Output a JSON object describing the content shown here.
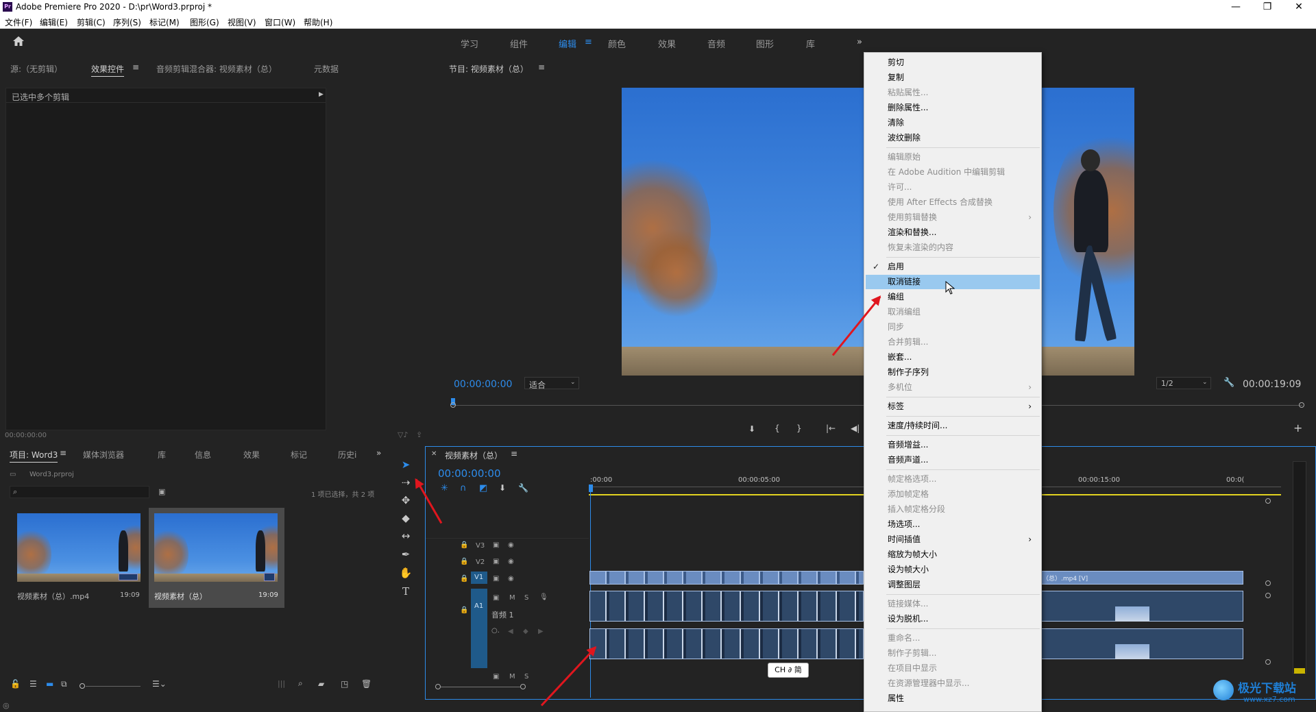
{
  "window": {
    "title": "Adobe Premiere Pro 2020 - D:\\pr\\Word3.prproj *",
    "app_icon": "Pr"
  },
  "menubar": [
    "文件(F)",
    "编辑(E)",
    "剪辑(C)",
    "序列(S)",
    "标记(M)",
    "图形(G)",
    "视图(V)",
    "窗口(W)",
    "帮助(H)"
  ],
  "workspaces": {
    "items": [
      "学习",
      "组件",
      "编辑",
      "颜色",
      "效果",
      "音频",
      "图形",
      "库"
    ],
    "active": "编辑",
    "more": "»"
  },
  "source_panel": {
    "tabs": [
      "源:（无剪辑）",
      "效果控件",
      "音频剪辑混合器: 视频素材（总）",
      "元数据"
    ],
    "active_tab": "效果控件",
    "row_label": "已选中多个剪辑",
    "timecode": "00:00:00:00"
  },
  "program_monitor": {
    "title": "节目: 视频素材（总）",
    "timecode_left": "00:00:00:00",
    "fit_label": "适合",
    "quality": "1/2",
    "timecode_right": "00:00:19:09"
  },
  "project_panel": {
    "tabs": [
      "项目: Word3",
      "媒体浏览器",
      "库",
      "信息",
      "效果",
      "标记",
      "历史i"
    ],
    "file": "Word3.prproj",
    "selection_info": "1 项已选择，共 2 项",
    "items": [
      {
        "name": "视频素材（总）.mp4",
        "duration": "19:09"
      },
      {
        "name": "视频素材（总）",
        "duration": "19:09"
      }
    ]
  },
  "timeline": {
    "title": "视频素材（总）",
    "timecode": "00:00:00:00",
    "ruler": [
      ":00:00",
      "00:00:05:00",
      "00:00:15:00",
      "00:0("
    ],
    "tracks": [
      "V3",
      "V2",
      "V1",
      "A1"
    ],
    "audio_track_name": "音频 1",
    "clip_label": "（总）.mp4 [V]",
    "ime": "CH ∂ 简"
  },
  "context_menu": {
    "items": [
      {
        "label": "剪切",
        "enabled": true
      },
      {
        "label": "复制",
        "enabled": true
      },
      {
        "label": "粘贴属性...",
        "enabled": false
      },
      {
        "label": "删除属性...",
        "enabled": true
      },
      {
        "label": "清除",
        "enabled": true
      },
      {
        "label": "波纹删除",
        "enabled": true
      },
      {
        "sep": true
      },
      {
        "label": "编辑原始",
        "enabled": false
      },
      {
        "label": "在 Adobe Audition 中编辑剪辑",
        "enabled": false
      },
      {
        "label": "许可...",
        "enabled": false
      },
      {
        "label": "使用 After Effects 合成替换",
        "enabled": false
      },
      {
        "label": "使用剪辑替换",
        "enabled": false,
        "submenu": true
      },
      {
        "label": "渲染和替换...",
        "enabled": true
      },
      {
        "label": "恢复未渲染的内容",
        "enabled": false
      },
      {
        "sep": true
      },
      {
        "label": "启用",
        "enabled": true,
        "checked": true
      },
      {
        "label": "取消链接",
        "enabled": true,
        "highlight": true
      },
      {
        "label": "编组",
        "enabled": true
      },
      {
        "label": "取消编组",
        "enabled": false
      },
      {
        "label": "同步",
        "enabled": false
      },
      {
        "label": "合并剪辑...",
        "enabled": false
      },
      {
        "label": "嵌套...",
        "enabled": true
      },
      {
        "label": "制作子序列",
        "enabled": true
      },
      {
        "label": "多机位",
        "enabled": false,
        "submenu": true
      },
      {
        "sep": true
      },
      {
        "label": "标签",
        "enabled": true,
        "submenu": true
      },
      {
        "sep": true
      },
      {
        "label": "速度/持续时间...",
        "enabled": true
      },
      {
        "sep": true
      },
      {
        "label": "音频增益...",
        "enabled": true
      },
      {
        "label": "音频声道...",
        "enabled": true
      },
      {
        "sep": true
      },
      {
        "label": "帧定格选项...",
        "enabled": false
      },
      {
        "label": "添加帧定格",
        "enabled": false
      },
      {
        "label": "插入帧定格分段",
        "enabled": false
      },
      {
        "label": "场选项...",
        "enabled": true
      },
      {
        "label": "时间插值",
        "enabled": true,
        "submenu": true
      },
      {
        "label": "缩放为帧大小",
        "enabled": true
      },
      {
        "label": "设为帧大小",
        "enabled": true
      },
      {
        "label": "调整图层",
        "enabled": true
      },
      {
        "sep": true
      },
      {
        "label": "链接媒体...",
        "enabled": false
      },
      {
        "label": "设为脱机...",
        "enabled": true
      },
      {
        "sep": true
      },
      {
        "label": "重命名...",
        "enabled": false
      },
      {
        "label": "制作子剪辑...",
        "enabled": false
      },
      {
        "label": "在项目中显示",
        "enabled": false
      },
      {
        "label": "在资源管理器中显示...",
        "enabled": false
      },
      {
        "label": "属性",
        "enabled": true
      }
    ]
  },
  "watermark": {
    "text": "极光下载站",
    "url": "www.xz7.com"
  },
  "colors": {
    "accent": "#2d8ceb",
    "highlight": "#99c9ef",
    "arrow": "#e0161e"
  }
}
